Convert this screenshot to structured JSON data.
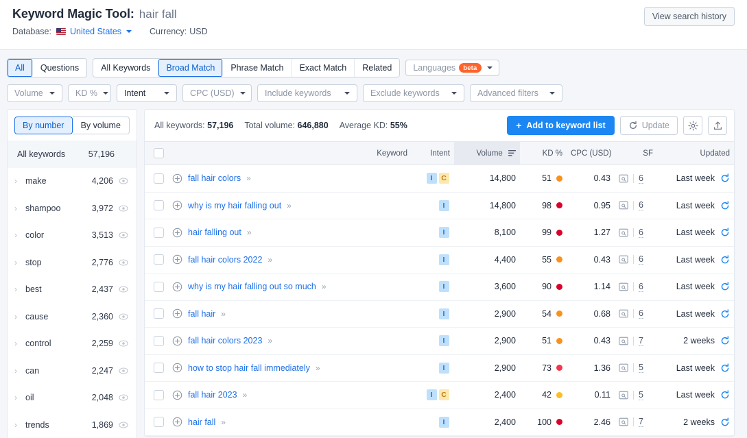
{
  "header": {
    "title_prefix": "Keyword Magic Tool:",
    "query": "hair fall",
    "database_label": "Database:",
    "database_value": "United States",
    "currency_label": "Currency:",
    "currency_value": "USD",
    "history_button": "View search history"
  },
  "filters": {
    "scope_tabs": [
      {
        "label": "All",
        "active": true
      },
      {
        "label": "Questions",
        "active": false
      }
    ],
    "match_tabs": [
      {
        "label": "All Keywords",
        "active": false
      },
      {
        "label": "Broad Match",
        "active": true
      },
      {
        "label": "Phrase Match",
        "active": false
      },
      {
        "label": "Exact Match",
        "active": false
      },
      {
        "label": "Related",
        "active": false
      }
    ],
    "languages": {
      "label": "Languages",
      "badge": "beta"
    },
    "dropdowns": [
      {
        "label": "Volume"
      },
      {
        "label": "KD %"
      },
      {
        "label": "Intent"
      },
      {
        "label": "CPC (USD)"
      },
      {
        "label": "Include keywords"
      },
      {
        "label": "Exclude keywords"
      },
      {
        "label": "Advanced filters"
      }
    ]
  },
  "sidebar": {
    "toggle": [
      {
        "label": "By number",
        "active": true
      },
      {
        "label": "By volume",
        "active": false
      }
    ],
    "all_keywords": {
      "label": "All keywords",
      "count": "57,196"
    },
    "groups": [
      {
        "label": "make",
        "count": "4,206"
      },
      {
        "label": "shampoo",
        "count": "3,972"
      },
      {
        "label": "color",
        "count": "3,513"
      },
      {
        "label": "stop",
        "count": "2,776"
      },
      {
        "label": "best",
        "count": "2,437"
      },
      {
        "label": "cause",
        "count": "2,360"
      },
      {
        "label": "control",
        "count": "2,259"
      },
      {
        "label": "can",
        "count": "2,247"
      },
      {
        "label": "oil",
        "count": "2,048"
      },
      {
        "label": "trends",
        "count": "1,869"
      }
    ]
  },
  "panel": {
    "summary": {
      "all_keywords_label": "All keywords:",
      "all_keywords_value": "57,196",
      "total_volume_label": "Total volume:",
      "total_volume_value": "646,880",
      "average_kd_label": "Average KD:",
      "average_kd_value": "55%"
    },
    "add_button": "Add to keyword list",
    "update_button": "Update",
    "settings_icon": "gear-icon",
    "export_icon": "export-icon",
    "columns": {
      "keyword": "Keyword",
      "intent": "Intent",
      "volume": "Volume",
      "kd": "KD %",
      "cpc": "CPC (USD)",
      "sf": "SF",
      "updated": "Updated"
    },
    "rows": [
      {
        "keyword": "fall hair colors",
        "intents": [
          "I",
          "C"
        ],
        "volume": "14,800",
        "kd": "51",
        "kd_color": "#f8921f",
        "cpc": "0.43",
        "sf": "6",
        "updated": "Last week"
      },
      {
        "keyword": "why is my hair falling out",
        "intents": [
          "I"
        ],
        "volume": "14,800",
        "kd": "98",
        "kd_color": "#d9022b",
        "cpc": "0.95",
        "sf": "6",
        "updated": "Last week"
      },
      {
        "keyword": "hair falling out",
        "intents": [
          "I"
        ],
        "volume": "8,100",
        "kd": "99",
        "kd_color": "#d9022b",
        "cpc": "1.27",
        "sf": "6",
        "updated": "Last week"
      },
      {
        "keyword": "fall hair colors 2022",
        "intents": [
          "I"
        ],
        "volume": "4,400",
        "kd": "55",
        "kd_color": "#f8921f",
        "cpc": "0.43",
        "sf": "6",
        "updated": "Last week"
      },
      {
        "keyword": "why is my hair falling out so much",
        "intents": [
          "I"
        ],
        "volume": "3,600",
        "kd": "90",
        "kd_color": "#d9022b",
        "cpc": "1.14",
        "sf": "6",
        "updated": "Last week"
      },
      {
        "keyword": "fall hair",
        "intents": [
          "I"
        ],
        "volume": "2,900",
        "kd": "54",
        "kd_color": "#f8921f",
        "cpc": "0.68",
        "sf": "6",
        "updated": "Last week"
      },
      {
        "keyword": "fall hair colors 2023",
        "intents": [
          "I"
        ],
        "volume": "2,900",
        "kd": "51",
        "kd_color": "#f8921f",
        "cpc": "0.43",
        "sf": "7",
        "updated": "2 weeks"
      },
      {
        "keyword": "how to stop hair fall immediately",
        "intents": [
          "I"
        ],
        "volume": "2,900",
        "kd": "73",
        "kd_color": "#f4364c",
        "cpc": "1.36",
        "sf": "5",
        "updated": "Last week"
      },
      {
        "keyword": "fall hair 2023",
        "intents": [
          "I",
          "C"
        ],
        "volume": "2,400",
        "kd": "42",
        "kd_color": "#ffbe1e",
        "cpc": "0.11",
        "sf": "5",
        "updated": "Last week"
      },
      {
        "keyword": "hair fall",
        "intents": [
          "I"
        ],
        "volume": "2,400",
        "kd": "100",
        "kd_color": "#d9022b",
        "cpc": "2.46",
        "sf": "7",
        "updated": "2 weeks"
      }
    ]
  }
}
